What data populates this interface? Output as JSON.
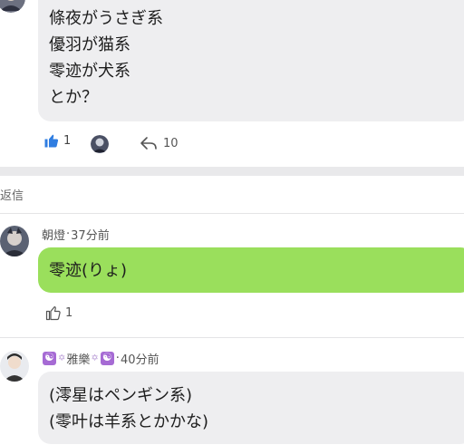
{
  "top_post": {
    "lines": [
      "條夜がうさぎ系",
      "優羽が猫系",
      "零迹が犬系",
      "とか？"
    ],
    "like_count": "1",
    "reply_count": "10"
  },
  "replies_section": {
    "label": "返信"
  },
  "reply1": {
    "author": "朝燈",
    "time": "37分前",
    "text": "零迹(りょ)",
    "like_count": "1"
  },
  "reply2": {
    "author": "雅樂",
    "time": "40分前",
    "lines": [
      "(澪星はペンギン系)",
      "(零叶は羊系とかかな)"
    ]
  },
  "colors": {
    "accent_blue": "#2f7de1",
    "bubble_green": "#9adf5c",
    "bubble_grey": "#eeeef0"
  },
  "icons": {
    "like_filled": "thumbs-up-icon",
    "like_outline": "thumbs-up-outline-icon",
    "reply": "reply-arrow-icon"
  }
}
